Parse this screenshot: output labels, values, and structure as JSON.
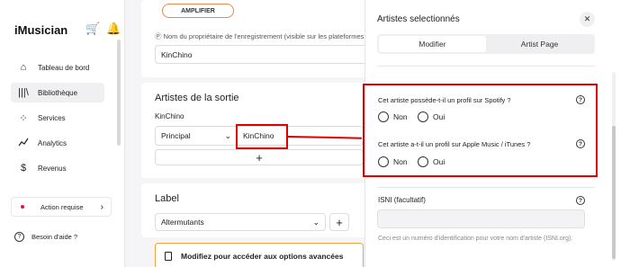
{
  "app": {
    "logo": "iMusician"
  },
  "sidebar": {
    "items": [
      {
        "label": "Tableau de bord",
        "icon": "home-icon"
      },
      {
        "label": "Bibliothèque",
        "icon": "library-icon",
        "active": true
      },
      {
        "label": "Services",
        "icon": "services-icon"
      },
      {
        "label": "Analytics",
        "icon": "analytics-icon"
      },
      {
        "label": "Revenus",
        "icon": "revenue-icon"
      }
    ],
    "action": "Action requise",
    "help": "Besoin d'aide ?"
  },
  "main": {
    "amplifier": "AMPLIFIER",
    "owner_label": "Ⓟ Nom du propriétaire de l'enregistrement (visible sur les plateformes",
    "owner_value": "KinChino",
    "artists_title": "Artistes de la sortie",
    "artist_name": "KinChino",
    "role": "Principal",
    "artist_field": "KinChino",
    "label_title": "Label",
    "label_value": "Altermutants",
    "upgrade_title": "Modifiez pour accéder aux options avancées"
  },
  "panel": {
    "title": "Artistes selectionnés",
    "tabs": [
      "Modifier",
      "Artist Page"
    ],
    "spotify_question": "Cet artiste possède-t-il un profil sur Spotify ?",
    "apple_question": "Cet artiste a-t-il un profil sur Apple Music / iTunes ?",
    "no": "Non",
    "yes": "Oui",
    "isni_label": "ISNI (facultatif)",
    "isni_help": "Ceci est un numéro d'identification pour votre nom d'artiste (ISNI.org)."
  },
  "colors": {
    "annotation": "#e00000",
    "warning_border": "#f2a33a",
    "status_dot": "#e5182e"
  }
}
